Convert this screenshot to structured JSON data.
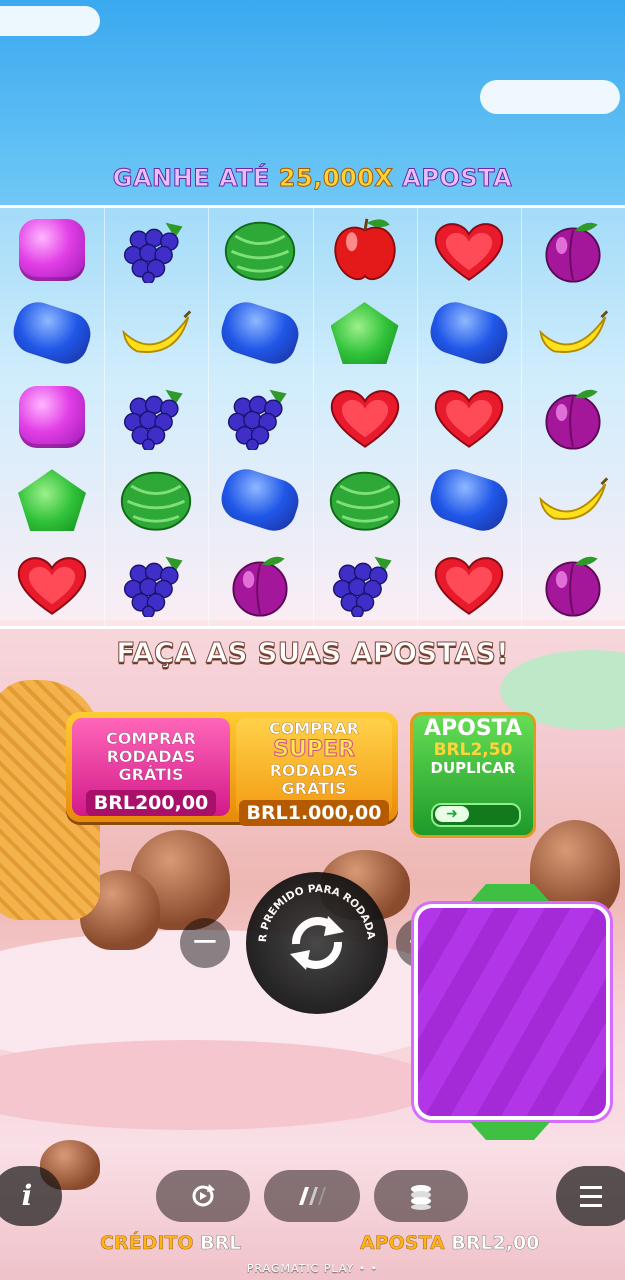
{
  "banner": {
    "prefix": "GANHE ATÉ",
    "multiplier": "25,000X",
    "suffix": "APOSTA"
  },
  "grid": {
    "reels": 6,
    "rows": 5,
    "symbols": [
      [
        "pink-square-candy",
        "grapes",
        "watermelon",
        "apple",
        "red-heart-candy",
        "plum"
      ],
      [
        "blue-oval-candy",
        "banana",
        "blue-oval-candy",
        "green-pentagon-candy",
        "blue-oval-candy",
        "banana"
      ],
      [
        "pink-square-candy",
        "grapes",
        "grapes",
        "red-heart-candy",
        "red-heart-candy",
        "plum"
      ],
      [
        "green-pentagon-candy",
        "watermelon",
        "blue-oval-candy",
        "watermelon",
        "blue-oval-candy",
        "banana"
      ],
      [
        "red-heart-candy",
        "grapes",
        "plum",
        "grapes",
        "red-heart-candy",
        "plum"
      ]
    ]
  },
  "status": {
    "message": "FAÇA AS SUAS APOSTAS!"
  },
  "buy_free_spins": {
    "line1": "COMPRAR",
    "line2": "RODADAS GRÁTIS",
    "price": "BRL200,00"
  },
  "buy_super_free_spins": {
    "line1": "COMPRAR",
    "line2": "SUPER",
    "line3": "RODADAS GRÁTIS",
    "price": "BRL1.000,00"
  },
  "ante_bet": {
    "title": "APOSTA",
    "value": "BRL2,50",
    "action": "DUPLICAR",
    "fine_print": "",
    "toggle_icon": "arrow-right-icon",
    "toggle_state": "off"
  },
  "spin": {
    "hold_text": "MANTER PREMIDO PARA RODADA TURBO",
    "icon": "spin-arrows-icon"
  },
  "controls": {
    "decrease_icon": "minus-icon",
    "increase_icon": "plus-icon",
    "info_label": "i",
    "autoplay_icon": "autoplay-icon",
    "turbo_icon": "turbo-icon",
    "bet_icon": "coin-stack-icon",
    "menu_icon": "menu-icon"
  },
  "footer": {
    "credit_label": "CRÉDITO",
    "credit_value": "BRL",
    "bet_label": "APOSTA",
    "bet_value": "BRL2,00",
    "provider": "PRAGMATIC PLAY"
  },
  "colors": {
    "banner_gold": "#ffd43a",
    "buy_pink": "#d21a8a",
    "buy_orange": "#f39b13",
    "ante_green": "#1e9a2a",
    "footer_gold": "#ffb21a",
    "special_box": "#b235e8"
  }
}
